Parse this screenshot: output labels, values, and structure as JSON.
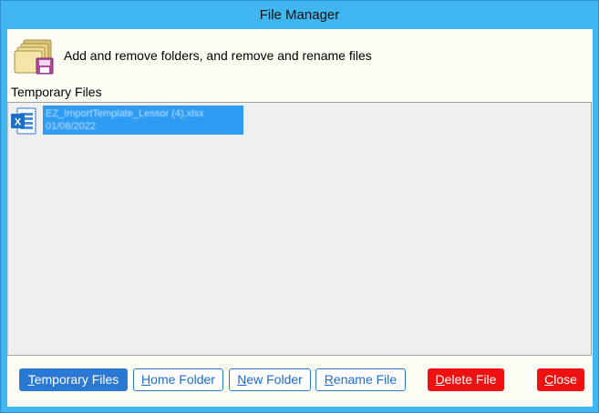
{
  "window": {
    "title": "File Manager"
  },
  "header": {
    "description": "Add and remove folders, and remove and rename files",
    "icon": "folders-disk-icon"
  },
  "section": {
    "label": "Temporary Files"
  },
  "files": [
    {
      "name": "EZ_ImportTemplate_Lessor (4).xlsx",
      "date": "01/08/2022",
      "icon": "excel-file-icon",
      "selected": true
    }
  ],
  "buttons": {
    "temporary_files": {
      "label": "Temporary Files",
      "accel": "T"
    },
    "home_folder": {
      "label": "Home Folder",
      "accel": "H"
    },
    "new_folder": {
      "label": "New Folder",
      "accel": "N"
    },
    "rename_file": {
      "label": "Rename File",
      "accel": "R"
    },
    "delete_file": {
      "label": "Delete File",
      "accel": "D"
    },
    "close": {
      "label": "Close",
      "accel": "C"
    }
  },
  "colors": {
    "accent": "#2a78d1",
    "title_bar": "#3fb6ef",
    "danger": "#ee1111",
    "selection": "#2e9cf2"
  }
}
